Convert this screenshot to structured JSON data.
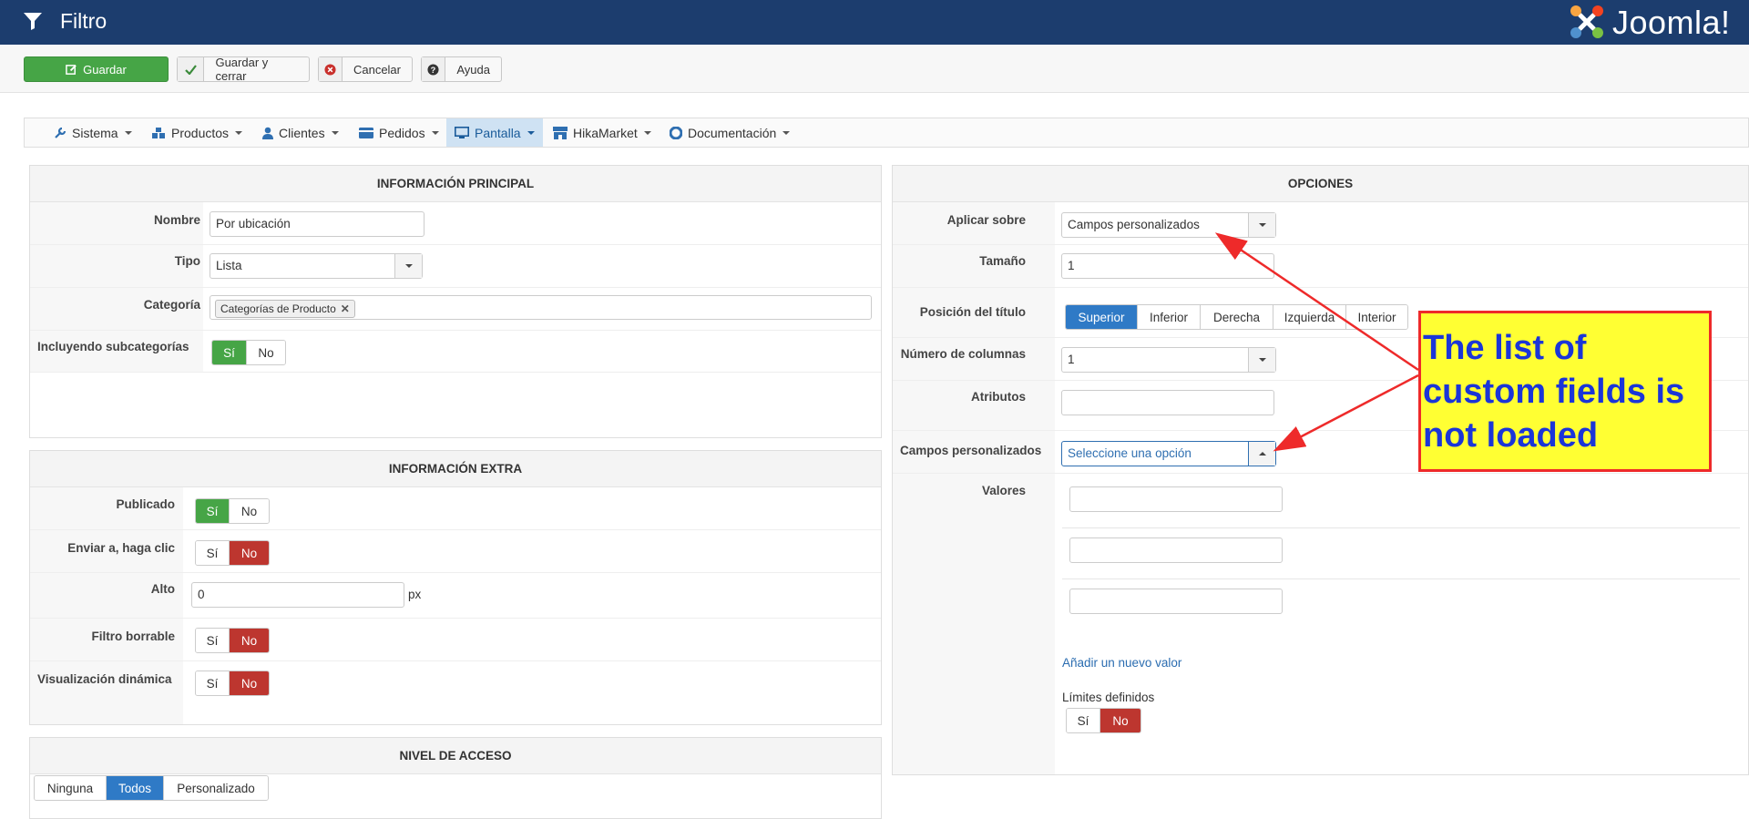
{
  "header": {
    "title": "Filtro",
    "brand": "Joomla!"
  },
  "toolbar": {
    "save": "Guardar",
    "save_close": "Guardar y cerrar",
    "cancel": "Cancelar",
    "help": "Ayuda"
  },
  "menu": {
    "items": [
      "Sistema",
      "Productos",
      "Clientes",
      "Pedidos",
      "Pantalla",
      "HikaMarket",
      "Documentación"
    ],
    "active": "Pantalla"
  },
  "main_info": {
    "heading": "INFORMACIÓN PRINCIPAL",
    "name_label": "Nombre",
    "name_value": "Por ubicación",
    "type_label": "Tipo",
    "type_value": "Lista",
    "category_label": "Categoría",
    "category_tag": "Categorías de Producto",
    "subcats_label": "Incluyendo subcategorías",
    "yes": "Sí",
    "no": "No"
  },
  "extra_info": {
    "heading": "INFORMACIÓN EXTRA",
    "published_label": "Publicado",
    "send_click_label": "Enviar a, haga clic",
    "height_label": "Alto",
    "height_value": "0",
    "height_unit": "px",
    "clearable_label": "Filtro borrable",
    "dynamic_label": "Visualización dinámica",
    "yes": "Sí",
    "no": "No"
  },
  "access": {
    "heading": "NIVEL DE ACCESO",
    "options": [
      "Ninguna",
      "Todos",
      "Personalizado"
    ],
    "selected": "Todos"
  },
  "options": {
    "heading": "OPCIONES",
    "apply_label": "Aplicar sobre",
    "apply_value": "Campos personalizados",
    "size_label": "Tamaño",
    "size_value": "1",
    "title_pos_label": "Posición del título",
    "title_pos_options": [
      "Superior",
      "Inferior",
      "Derecha",
      "Izquierda",
      "Interior"
    ],
    "title_pos_selected": "Superior",
    "columns_label": "Número de columnas",
    "columns_value": "1",
    "attributes_label": "Atributos",
    "custom_fields_label": "Campos personalizados",
    "custom_fields_placeholder": "Seleccione una opción",
    "values_label": "Valores",
    "add_value_link": "Añadir un nuevo valor",
    "limits_label": "Límites definidos",
    "yes": "Sí",
    "no": "No"
  },
  "annotation": {
    "text": "The list of custom fields is not loaded"
  },
  "colors": {
    "header_bg": "#1c3d6e",
    "success": "#46a546",
    "danger": "#bd362f",
    "primary": "#2f7ac6",
    "annotation_bg": "#ffff33",
    "annotation_border": "#ee2a2a",
    "annotation_text": "#1b35d8"
  }
}
